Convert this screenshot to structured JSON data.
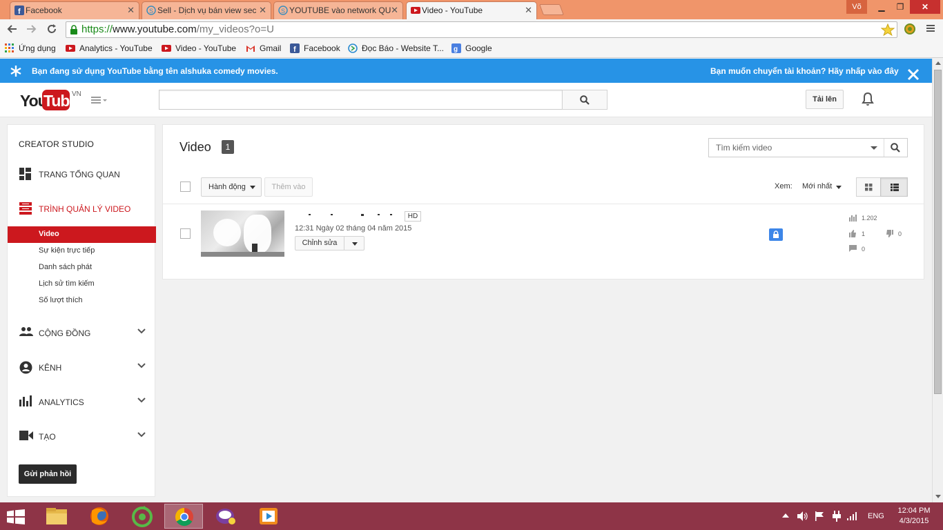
{
  "browser": {
    "tabs": [
      {
        "title": "Facebook",
        "active": false
      },
      {
        "title": "Sell - Dịch vụ bán view sec",
        "active": false
      },
      {
        "title": "YOUTUBE vào network QU",
        "active": false
      },
      {
        "title": "Video - YouTube",
        "active": true
      }
    ],
    "user": "Võ",
    "url_scheme": "https://",
    "url_host": "www.youtube.com",
    "url_path": "/my_videos?o=U",
    "bookmarks": [
      {
        "label": "Ứng dụng",
        "icon": "apps-grid-icon"
      },
      {
        "label": "Analytics - YouTube",
        "icon": "youtube-icon"
      },
      {
        "label": "Video - YouTube",
        "icon": "youtube-icon"
      },
      {
        "label": "Gmail",
        "icon": "gmail-icon"
      },
      {
        "label": "Facebook",
        "icon": "facebook-icon"
      },
      {
        "label": "Đọc Báo - Website T...",
        "icon": "coccoc-icon"
      },
      {
        "label": "Google",
        "icon": "google-icon"
      }
    ]
  },
  "banner": {
    "left_text": "Bạn đang sử dụng YouTube bằng tên alshuka comedy movies.",
    "right_text": "Bạn muốn chuyển tài khoản? Hãy nhấp vào đây"
  },
  "header": {
    "logo_you": "You",
    "logo_tube": "Tube",
    "logo_region": "VN",
    "upload_label": "Tải lên"
  },
  "sidebar": {
    "title": "CREATOR STUDIO",
    "dashboard": "TRANG TỔNG QUAN",
    "video_manager": "TRÌNH QUẢN LÝ VIDEO",
    "sub_items": [
      "Video",
      "Sự kiện trực tiếp",
      "Danh sách phát",
      "Lịch sử tìm kiếm",
      "Số lượt thích"
    ],
    "community": "CỘNG ĐỒNG",
    "channel": "KÊNH",
    "analytics": "ANALYTICS",
    "create": "TẠO",
    "feedback_button": "Gửi phản hồi"
  },
  "main": {
    "title": "Video",
    "count": "1",
    "search_placeholder": "Tìm kiếm video",
    "actions_label": "Hành động",
    "add_to_label": "Thêm vào",
    "view_label": "Xem:",
    "sort_label": "Mới nhất",
    "video": {
      "hd_badge": "HD",
      "date": "12:31 Ngày 02 tháng 04 năm 2015",
      "edit_label": "Chỉnh sửa",
      "views": "1.202",
      "likes": "1",
      "dislikes": "0",
      "comments": "0"
    }
  },
  "taskbar": {
    "language": "ENG",
    "time": "12:04 PM",
    "date": "4/3/2015"
  },
  "colors": {
    "banner": "#2793e6",
    "accent_red": "#cc181e",
    "taskbar": "#8e3447",
    "tabstrip": "#f0956a"
  }
}
